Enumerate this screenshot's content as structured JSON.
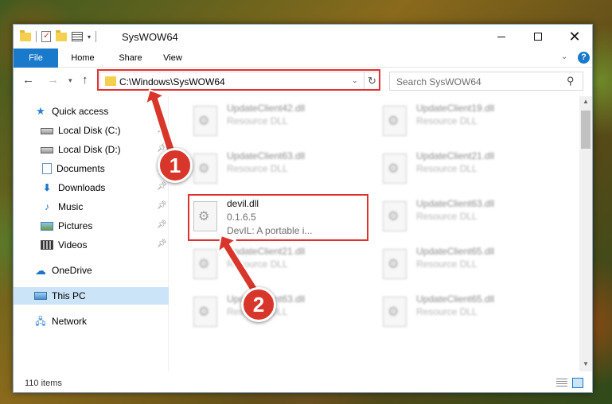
{
  "window": {
    "title": "SysWOW64",
    "controls": {
      "minimize": "—",
      "maximize": "☐",
      "close": "✕"
    }
  },
  "ribbon": {
    "tabs": [
      "File",
      "Home",
      "Share",
      "View"
    ],
    "help_icon": "?"
  },
  "address": {
    "path": "C:\\Windows\\SysWOW64",
    "search_placeholder": "Search SysWOW64"
  },
  "sidebar": {
    "items": [
      {
        "label": "Quick access",
        "icon": "star-icon"
      },
      {
        "label": "Local Disk (C:)",
        "icon": "drive-icon"
      },
      {
        "label": "Local Disk (D:)",
        "icon": "drive-icon"
      },
      {
        "label": "Documents",
        "icon": "documents-icon"
      },
      {
        "label": "Downloads",
        "icon": "downloads-icon"
      },
      {
        "label": "Music",
        "icon": "music-icon"
      },
      {
        "label": "Pictures",
        "icon": "pictures-icon"
      },
      {
        "label": "Videos",
        "icon": "videos-icon"
      },
      {
        "label": "OneDrive",
        "icon": "cloud-icon"
      },
      {
        "label": "This PC",
        "icon": "computer-icon"
      },
      {
        "label": "Network",
        "icon": "network-icon"
      }
    ]
  },
  "files": {
    "col1": [
      {
        "name": "UpdateClient42.dll",
        "desc": "Resource DLL"
      },
      {
        "name": "UpdateClient63.dll",
        "desc": "Resource DLL"
      },
      {
        "name": "devil.dll",
        "version": "0.1.6.5",
        "desc": "DevIL: A portable i..."
      },
      {
        "name": "UpdateClient21.dll",
        "desc": "Resource DLL"
      },
      {
        "name": "UpdateClient63.dll",
        "desc": "Resource DLL"
      }
    ],
    "col2": [
      {
        "name": "UpdateClient19.dll",
        "desc": "Resource DLL"
      },
      {
        "name": "UpdateClient21.dll",
        "desc": "Resource DLL"
      },
      {
        "name": "UpdateClient63.dll",
        "desc": "Resource DLL"
      },
      {
        "name": "UpdateClient65.dll",
        "desc": "Resource DLL"
      },
      {
        "name": "UpdateClient65.dll",
        "desc": "Resource DLL"
      }
    ]
  },
  "status": {
    "item_count": "110 items"
  },
  "annotations": {
    "step1": "1",
    "step2": "2",
    "color": "#d8362b"
  }
}
